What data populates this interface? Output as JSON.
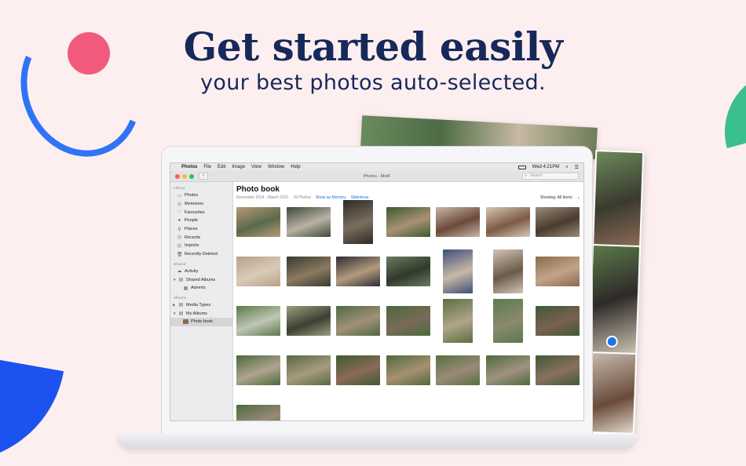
{
  "hero": {
    "title": "Get started easily",
    "subtitle": "your best photos auto-selected."
  },
  "menubar": {
    "apple": "",
    "app": "Photos",
    "items": [
      "File",
      "Edit",
      "Image",
      "View",
      "Window",
      "Help"
    ],
    "clock": "Wed  4:21PM"
  },
  "window": {
    "title": "Photos - MotF",
    "search_placeholder": "Search",
    "back": "‹"
  },
  "sidebar": {
    "library_header": "Library",
    "library": [
      {
        "label": "Photos",
        "icon": "photos-icon"
      },
      {
        "label": "Memories",
        "icon": "memories-icon"
      },
      {
        "label": "Favourites",
        "icon": "heart-icon"
      },
      {
        "label": "People",
        "icon": "person-icon"
      },
      {
        "label": "Places",
        "icon": "pin-icon"
      },
      {
        "label": "Recents",
        "icon": "clock-icon"
      },
      {
        "label": "Imports",
        "icon": "import-icon"
      },
      {
        "label": "Recently Deleted",
        "icon": "trash-icon"
      }
    ],
    "shared_header": "Shared",
    "shared": [
      {
        "label": "Activity",
        "icon": "cloud-icon"
      },
      {
        "label": "Shared Albums",
        "icon": "folder-icon"
      },
      {
        "label": "Adverts",
        "icon": "album-icon"
      }
    ],
    "albums_header": "Albums",
    "albums": [
      {
        "label": "Media Types",
        "icon": "folder-icon"
      },
      {
        "label": "My Albums",
        "icon": "folder-icon"
      },
      {
        "label": "Photo book",
        "icon": "photo-thumb-icon"
      }
    ]
  },
  "album": {
    "title": "Photo book",
    "date_range": "November 2014 - March 2021",
    "count": "29 Photos",
    "show_as_memory": "Show as Memory",
    "slideshow": "Slideshow",
    "showing": "Showing: All Items"
  },
  "photos": [
    {
      "c1": "#b79a78",
      "c2": "#5b6a4a"
    },
    {
      "c1": "#3d4a3a",
      "c2": "#b9b2a4"
    },
    {
      "c1": "#2f2a26",
      "c2": "#7a6f5e"
    },
    {
      "c1": "#3c5a33",
      "c2": "#a89172"
    },
    {
      "c1": "#c8b6a8",
      "c2": "#6b4a3b"
    },
    {
      "c1": "#d6c7b6",
      "c2": "#7d5a45"
    },
    {
      "c1": "#9a8c7a",
      "c2": "#4a3b2f"
    },
    {
      "c1": "#b7a08a",
      "c2": "#d9cbb8"
    },
    {
      "c1": "#3a3a30",
      "c2": "#8a7a60"
    },
    {
      "c1": "#2d2d35",
      "c2": "#b39a7c"
    },
    {
      "c1": "#6d7a60",
      "c2": "#2f3a2a"
    },
    {
      "c1": "#3d4f7a",
      "c2": "#c9b9a6"
    },
    {
      "c1": "#d2c5b5",
      "c2": "#6a5a4a"
    },
    {
      "c1": "#8a6a50",
      "c2": "#c4a487"
    },
    {
      "c1": "#5a7a4a",
      "c2": "#c0c6b5"
    },
    {
      "c1": "#9aa080",
      "c2": "#3d3f30"
    },
    {
      "c1": "#4f6a40",
      "c2": "#a0907a"
    },
    {
      "c1": "#4a6a3a",
      "c2": "#7a6a5a"
    },
    {
      "c1": "#5a7040",
      "c2": "#b0a58a"
    },
    {
      "c1": "#5d7a4a",
      "c2": "#8a8a70"
    },
    {
      "c1": "#3f5a3a",
      "c2": "#7a6050"
    },
    {
      "c1": "#4a6a3a",
      "c2": "#b0a490"
    },
    {
      "c1": "#566a40",
      "c2": "#a89a80"
    },
    {
      "c1": "#3d5a30",
      "c2": "#8a6a58"
    },
    {
      "c1": "#4f6a3a",
      "c2": "#a89070"
    },
    {
      "c1": "#567040",
      "c2": "#9a8a78"
    },
    {
      "c1": "#4d6a3d",
      "c2": "#a09280"
    },
    {
      "c1": "#3f5a35",
      "c2": "#8a7060"
    },
    {
      "c1": "#4a6a3f",
      "c2": "#9a8a78"
    }
  ],
  "colors": {
    "headline": "#17295a",
    "accent_link": "#1d6fe2",
    "light_red": "#fd5f57",
    "light_yellow": "#fdbc2e",
    "light_green": "#28c840"
  }
}
